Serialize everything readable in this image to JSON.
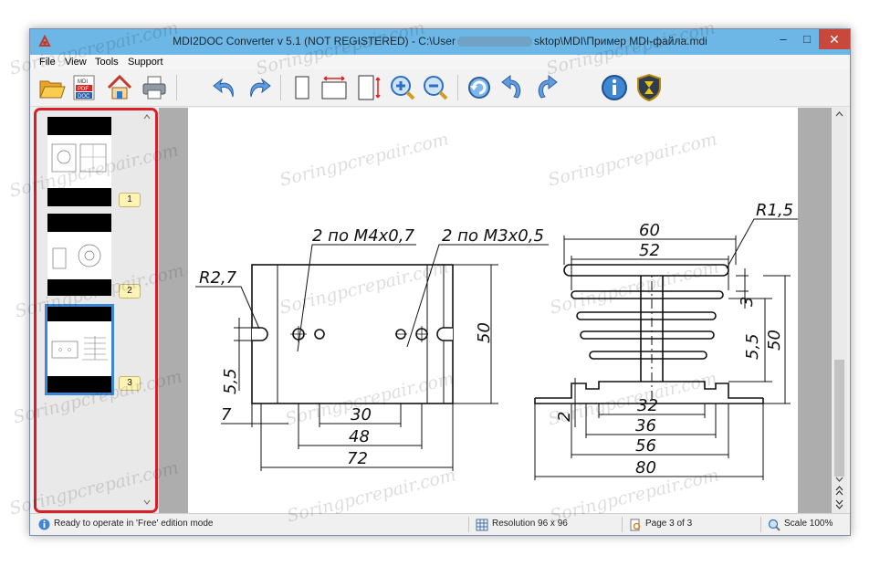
{
  "window": {
    "title_left": "MDI2DOC Converter v 5.1   (NOT REGISTERED)  -  C:\\User",
    "title_right": "sktop\\MDI\\Пример MDI-файла.mdi",
    "minimize": "–",
    "maximize": "□",
    "close": "✕"
  },
  "menu": [
    "File",
    "View",
    "Tools",
    "Support"
  ],
  "toolbar_icons": [
    "open-folder-icon",
    "mdi-pdf-doc-icon",
    "convert-to-house-icon",
    "print-icon",
    "undo-icon",
    "redo-icon",
    "fit-page-icon",
    "fit-width-icon",
    "fit-height-icon",
    "zoom-in-icon",
    "zoom-out-icon",
    "rotate-icon",
    "rotate-left-icon",
    "rotate-right-icon",
    "info-icon",
    "hourglass-shield-icon"
  ],
  "thumbnails": [
    {
      "page": "1",
      "selected": false
    },
    {
      "page": "2",
      "selected": false
    },
    {
      "page": "3",
      "selected": true
    }
  ],
  "drawing": {
    "left": {
      "label_r": "R2,7",
      "label_m4": "2 по М4х0,7",
      "label_m3": "2 по М3х0,5",
      "dim_50": "50",
      "dim_55": "5,5",
      "dim_7": "7",
      "dim_30": "30",
      "dim_48": "48",
      "dim_72": "72"
    },
    "right": {
      "label_r": "R1,5",
      "dim_60": "60",
      "dim_52": "52",
      "dim_3": "3",
      "dim_55": "5,5",
      "dim_50": "50",
      "dim_32": "32",
      "dim_36": "36",
      "dim_56": "56",
      "dim_80": "80",
      "dim_2": "2"
    }
  },
  "status": {
    "ready": "Ready to operate in 'Free' edition mode",
    "resolution": "Resolution 96 x 96",
    "page": "Page 3 of 3",
    "scale": "Scale 100%"
  },
  "watermark": "Soringpcrepair.com",
  "colors": {
    "titlebar": "#6cb7e6",
    "close": "#c9483c",
    "highlight": "#d8202a",
    "selected_thumb": "#3b87d6"
  }
}
